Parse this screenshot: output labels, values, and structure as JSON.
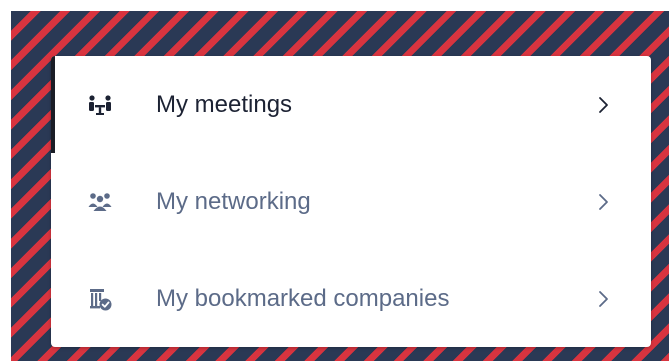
{
  "menu": {
    "items": [
      {
        "label": "My meetings",
        "icon": "meeting-table-icon",
        "active": true
      },
      {
        "label": "My networking",
        "icon": "people-group-icon",
        "active": false
      },
      {
        "label": "My bookmarked companies",
        "icon": "building-check-icon",
        "active": false
      }
    ]
  },
  "colors": {
    "stripe_navy": "#2a3955",
    "stripe_red": "#d8343f",
    "active_text": "#1c2233",
    "inactive_text": "#5c6b88",
    "active_indicator": "#1a1d26",
    "chevron": "#5c6b88"
  }
}
